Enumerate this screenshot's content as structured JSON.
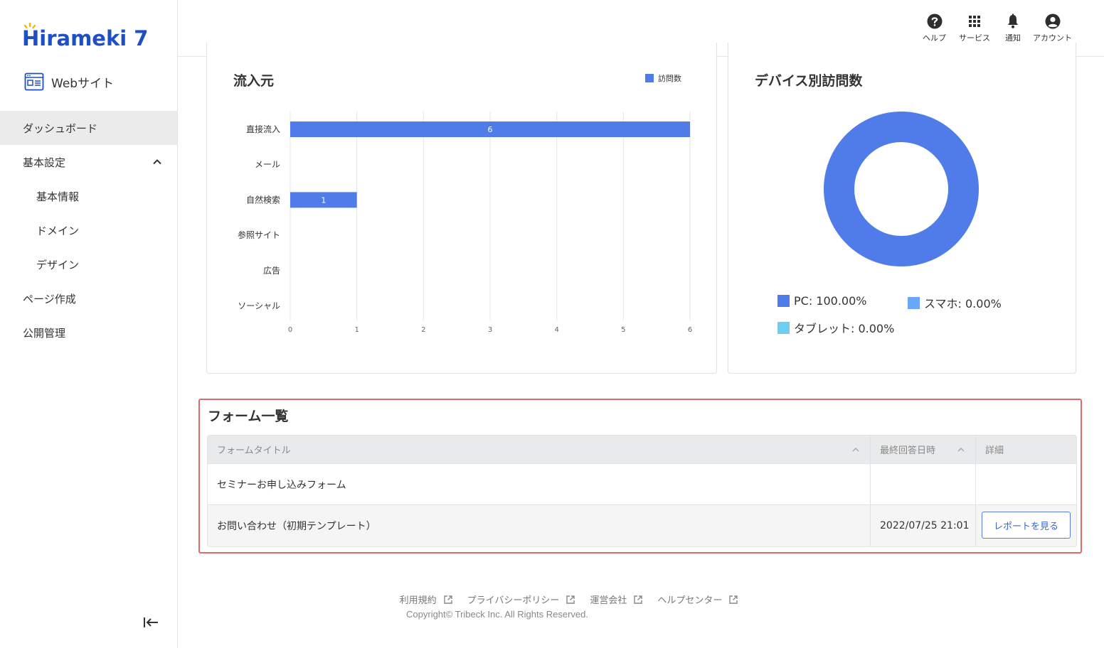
{
  "brand": {
    "logo_text": "Hirameki 7"
  },
  "sidebar": {
    "site_label": "Webサイト",
    "items": [
      {
        "label": "ダッシュボード",
        "active": true
      },
      {
        "label": "基本設定",
        "expanded": true
      },
      {
        "label": "基本情報",
        "sub": true
      },
      {
        "label": "ドメイン",
        "sub": true
      },
      {
        "label": "デザイン",
        "sub": true
      },
      {
        "label": "ページ作成"
      },
      {
        "label": "公開管理"
      }
    ]
  },
  "header": {
    "help": "ヘルプ",
    "services": "サービス",
    "notifications": "通知",
    "account": "アカウント"
  },
  "traffic_card": {
    "title": "流入元"
  },
  "device_card": {
    "title": "デバイス別訪問数"
  },
  "chart_data": [
    {
      "type": "bar",
      "orientation": "horizontal",
      "title": "流入元",
      "categories": [
        "直接流入",
        "メール",
        "自然検索",
        "参照サイト",
        "広告",
        "ソーシャル"
      ],
      "series": [
        {
          "name": "訪問数",
          "values": [
            6,
            0,
            1,
            0,
            0,
            0
          ],
          "color": "#4f7ce8"
        }
      ],
      "xlim": [
        0,
        6
      ],
      "xticks": [
        "0",
        "1",
        "2",
        "3",
        "4",
        "5",
        "6"
      ],
      "data_labels": [
        "6",
        "",
        "1",
        "",
        "",
        ""
      ],
      "grid": true,
      "legend_position": "top-right"
    },
    {
      "type": "pie",
      "variant": "donut",
      "title": "デバイス別訪問数",
      "slices": [
        {
          "label": "PC",
          "value": 100.0,
          "color": "#4f7ce8",
          "legend_text": "PC: 100.00%"
        },
        {
          "label": "スマホ",
          "value": 0.0,
          "color": "#6aa8f7",
          "legend_text": "スマホ: 0.00%"
        },
        {
          "label": "タブレット",
          "value": 0.0,
          "color": "#6fcdf0",
          "legend_text": "タブレット: 0.00%"
        }
      ],
      "legend_position": "bottom"
    }
  ],
  "forms": {
    "title": "フォーム一覧",
    "columns": [
      "フォームタイトル",
      "最終回答日時",
      "詳細"
    ],
    "rows": [
      {
        "title": "セミナーお申し込みフォーム",
        "last_answer": "",
        "action": ""
      },
      {
        "title": "お問い合わせ（初期テンプレート）",
        "last_answer": "2022/07/25 21:01",
        "action": "レポートを見る"
      }
    ]
  },
  "footer": {
    "links": [
      "利用規約",
      "プライバシーポリシー",
      "運営会社",
      "ヘルプセンター"
    ],
    "copyright": "Copyright© Tribeck Inc. All Rights Reserved."
  },
  "colors": {
    "accent": "#4f7ce8",
    "brand": "#1f4fc4",
    "highlight_border": "#e06868"
  }
}
